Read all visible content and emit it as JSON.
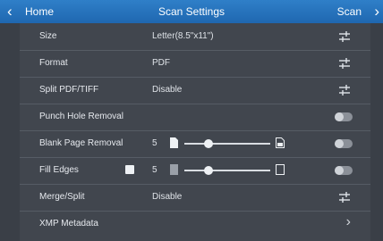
{
  "topbar": {
    "back_label": "Home",
    "title": "Scan Settings",
    "scan_label": "Scan",
    "back_icon": "chevron-left-icon",
    "forward_icon": "chevron-right-icon"
  },
  "rows": [
    {
      "label": "Size",
      "value": "Letter(8.5\"x11\")",
      "control": "edit"
    },
    {
      "label": "Format",
      "value": "PDF",
      "control": "edit"
    },
    {
      "label": "Split PDF/TIFF",
      "value": "Disable",
      "control": "edit"
    },
    {
      "label": "Punch Hole Removal",
      "value": "",
      "control": "toggle",
      "state": "off"
    },
    {
      "label": "Blank Page Removal",
      "value": "5",
      "control": "slider+toggle",
      "slider_level": 0.3,
      "state": "off"
    },
    {
      "label": "Fill Edges",
      "value": "5",
      "control": "checkbox+slider+toggle",
      "checked": true,
      "slider_level": 0.3,
      "state": "off"
    },
    {
      "label": "Merge/Split",
      "value": "Disable",
      "control": "edit"
    },
    {
      "label": "XMP Metadata",
      "value": "",
      "control": "chevron"
    }
  ],
  "colors": {
    "header": "#2873bd",
    "background": "#3a3f47",
    "toggle_off": "#8b9098"
  }
}
